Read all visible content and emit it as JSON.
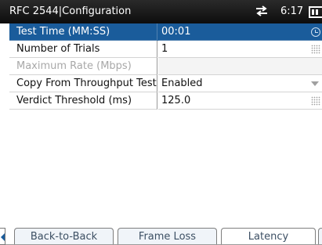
{
  "titlebar": {
    "title": "RFC 2544|Configuration",
    "time": "6:17",
    "network_icon": "network-transfer-icon",
    "battery_icon": "battery-icon"
  },
  "settings": [
    {
      "label": "Test Time (MM:SS)",
      "value": "00:01",
      "state": "selected",
      "control": "time-picker"
    },
    {
      "label": "Number of Trials",
      "value": "1",
      "state": "normal",
      "control": "keypad"
    },
    {
      "label": "Maximum Rate (Mbps)",
      "value": "",
      "state": "disabled",
      "control": "none"
    },
    {
      "label": "Copy From Throughput Test",
      "value": "Enabled",
      "state": "normal",
      "control": "dropdown"
    },
    {
      "label": "Verdict Threshold (ms)",
      "value": "125.0",
      "state": "normal",
      "control": "keypad"
    }
  ],
  "tabs": [
    {
      "label": "Back-to-Back",
      "active": false
    },
    {
      "label": "Frame Loss",
      "active": false
    },
    {
      "label": "Latency",
      "active": true
    }
  ],
  "colors": {
    "selected": "#1a5c9b",
    "titlebar": "#111111"
  }
}
